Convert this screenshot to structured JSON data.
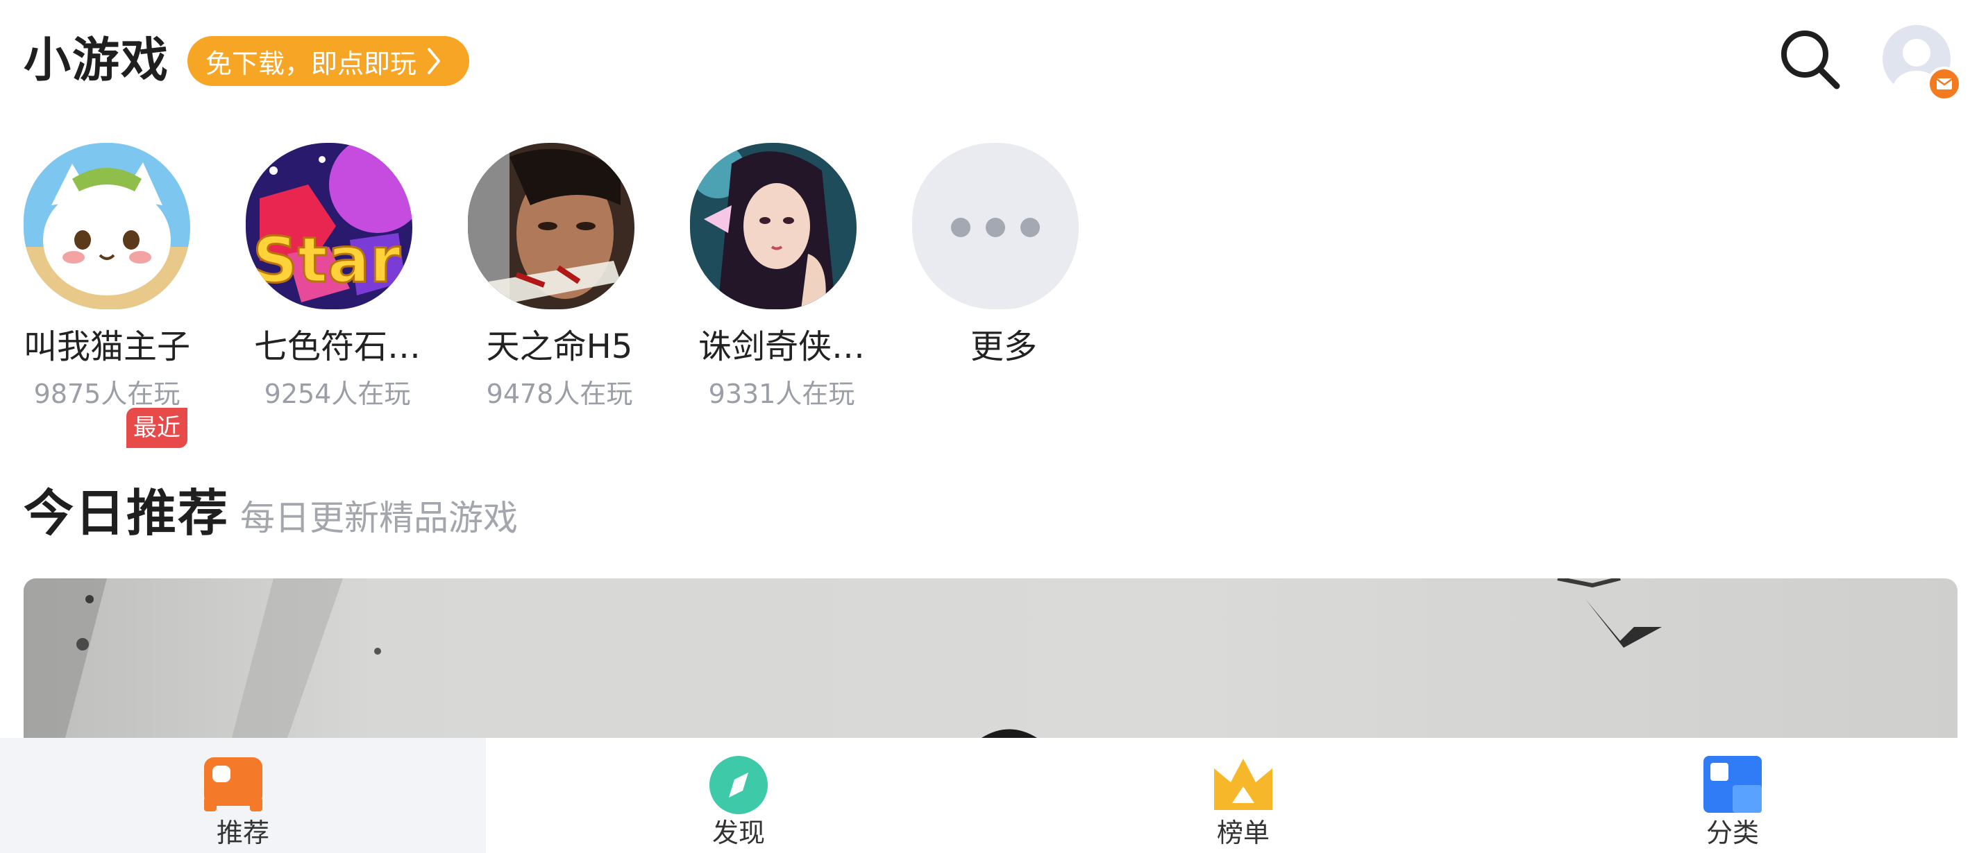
{
  "header": {
    "title": "小游戏",
    "promo": "免下载，即点即玩"
  },
  "games": [
    {
      "name": "叫我猫主子",
      "players": "9875人在玩",
      "badge": "最近",
      "icon": "cat-game-icon"
    },
    {
      "name": "七色符石…",
      "players": "9254人在玩",
      "icon": "gem-star-game-icon"
    },
    {
      "name": "天之命H5",
      "players": "9478人在玩",
      "icon": "warrior-game-icon"
    },
    {
      "name": "诛剑奇侠…",
      "players": "9331人在玩",
      "icon": "heroine-game-icon"
    },
    {
      "name": "更多",
      "icon": "more-dots-icon"
    }
  ],
  "section": {
    "title": "今日推荐",
    "subtitle": "每日更新精品游戏"
  },
  "tabs": [
    {
      "label": "推荐",
      "icon": "gamepad-icon",
      "active": true
    },
    {
      "label": "发现",
      "icon": "compass-icon"
    },
    {
      "label": "榜单",
      "icon": "crown-icon"
    },
    {
      "label": "分类",
      "icon": "category-icon"
    }
  ],
  "colors": {
    "accent_orange": "#f7a524",
    "badge_red": "#e84a4a",
    "tab_teal": "#3ec9a9",
    "tab_blue": "#2f7cf6",
    "text_muted": "#9a9ea6"
  }
}
